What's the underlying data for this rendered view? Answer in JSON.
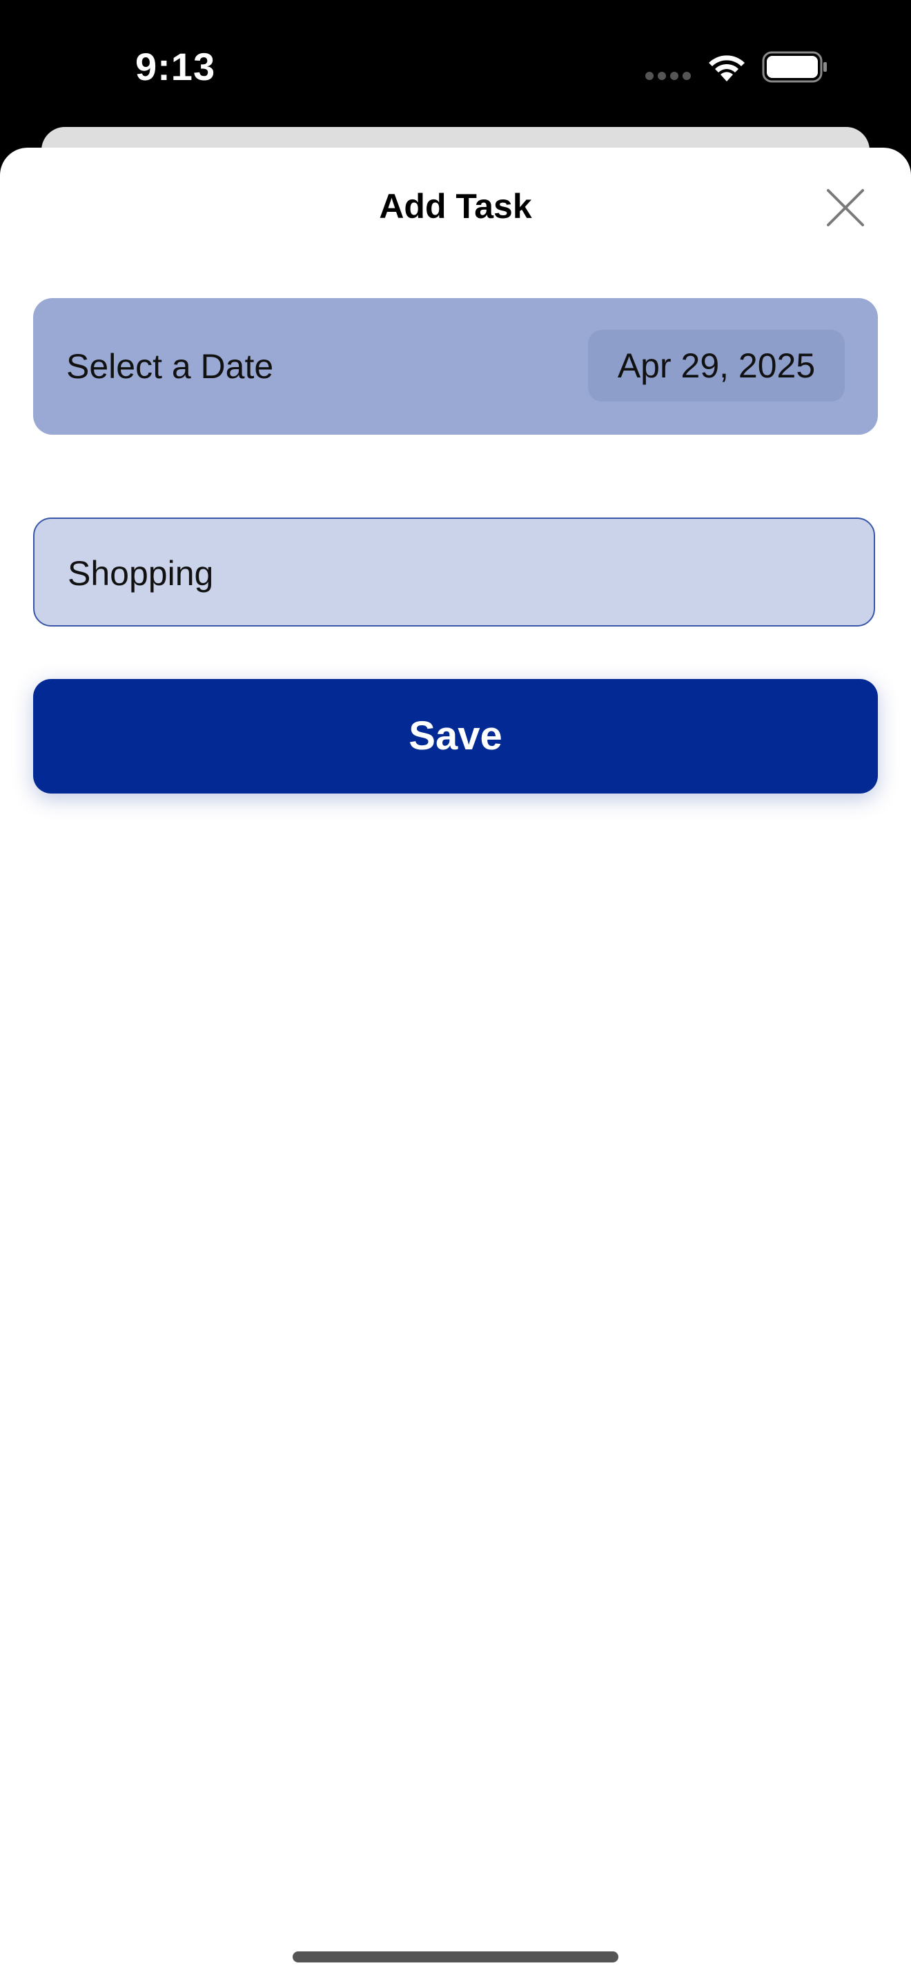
{
  "status_bar": {
    "time": "9:13"
  },
  "sheet": {
    "title": "Add Task",
    "close_icon": "close-icon"
  },
  "date_picker": {
    "label": "Select a Date",
    "value": "Apr 29, 2025"
  },
  "task_input": {
    "value": "Shopping"
  },
  "save_button": {
    "label": "Save"
  },
  "colors": {
    "date_row_bg": "#99a9d4",
    "date_pill_bg": "#8d9ecb",
    "input_bg": "#cad3e9",
    "input_border": "#3a56a8",
    "save_bg": "#032a94",
    "save_text": "#ffffff"
  }
}
